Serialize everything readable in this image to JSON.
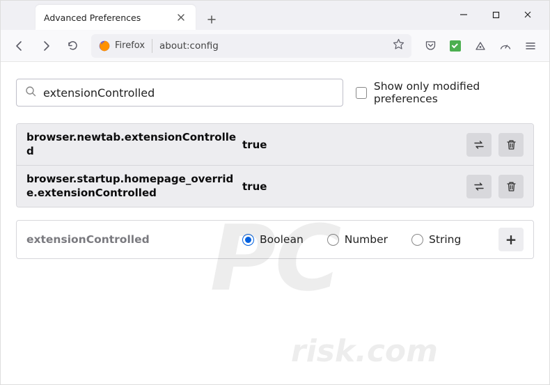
{
  "tab": {
    "title": "Advanced Preferences"
  },
  "urlbar": {
    "identity": "Firefox",
    "url": "about:config"
  },
  "search": {
    "value": "extensionControlled",
    "modified_only_label": "Show only modified preferences"
  },
  "prefs": [
    {
      "name": "browser.newtab.extensionControlled",
      "value": "true"
    },
    {
      "name": "browser.startup.homepage_override.extensionControlled",
      "value": "true"
    }
  ],
  "new_pref": {
    "name": "extensionControlled",
    "types": [
      "Boolean",
      "Number",
      "String"
    ],
    "selected": "Boolean"
  },
  "watermark": {
    "big": "PC",
    "small": "risk.com"
  }
}
